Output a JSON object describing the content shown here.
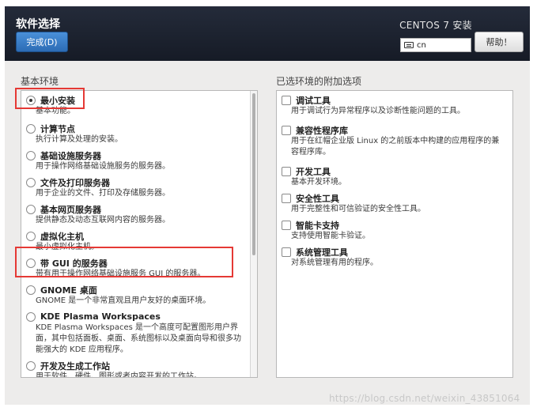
{
  "header": {
    "title": "软件选择",
    "done_button": "完成(D)",
    "product": "CENTOS 7 安装",
    "keyboard_layout": "cn",
    "help_button": "帮助！"
  },
  "base_environment": {
    "label": "基本环境",
    "selected_index": 0,
    "items": [
      {
        "name": "最小安装",
        "desc": "基本功能。"
      },
      {
        "name": "计算节点",
        "desc": "执行计算及处理的安装。"
      },
      {
        "name": "基础设施服务器",
        "desc": "用于操作网络基础设施服务的服务器。"
      },
      {
        "name": "文件及打印服务器",
        "desc": "用于企业的文件、打印及存储服务器。"
      },
      {
        "name": "基本网页服务器",
        "desc": "提供静态及动态互联网内容的服务器。"
      },
      {
        "name": "虚拟化主机",
        "desc": "最小虚拟化主机。"
      },
      {
        "name": "带 GUI 的服务器",
        "desc": "带有用于操作网络基础设施服务 GUI 的服务器。"
      },
      {
        "name": "GNOME 桌面",
        "desc": "GNOME 是一个非常直观且用户友好的桌面环境。"
      },
      {
        "name": "KDE Plasma Workspaces",
        "desc": "KDE Plasma Workspaces 是一个高度可配置图形用户界面，其中包括面板、桌面、系统图标以及桌面向导和很多功能强大的 KDE 应用程序。"
      },
      {
        "name": "开发及生成工作站",
        "desc": "用于软件、硬件、图形或者内容开发的工作站。"
      }
    ]
  },
  "addons": {
    "label": "已选环境的附加选项",
    "items": [
      {
        "name": "调试工具",
        "desc": "用于调试行为异常程序以及诊断性能问题的工具。"
      },
      {
        "name": "兼容性程序库",
        "desc": "用于在红帽企业版 Linux 的之前版本中构建的应用程序的兼容程序库。"
      },
      {
        "name": "开发工具",
        "desc": "基本开发环境。"
      },
      {
        "name": "安全性工具",
        "desc": "用于完整性和可信验证的安全性工具。"
      },
      {
        "name": "智能卡支持",
        "desc": "支持使用智能卡验证。"
      },
      {
        "name": "系统管理工具",
        "desc": "对系统管理有用的程序。"
      }
    ]
  },
  "watermark": "https://blog.csdn.net/weixin_43851064",
  "colors": {
    "header_bg": "#1c2230",
    "done_button": "#3a7bd5",
    "highlight": "#e53935"
  }
}
